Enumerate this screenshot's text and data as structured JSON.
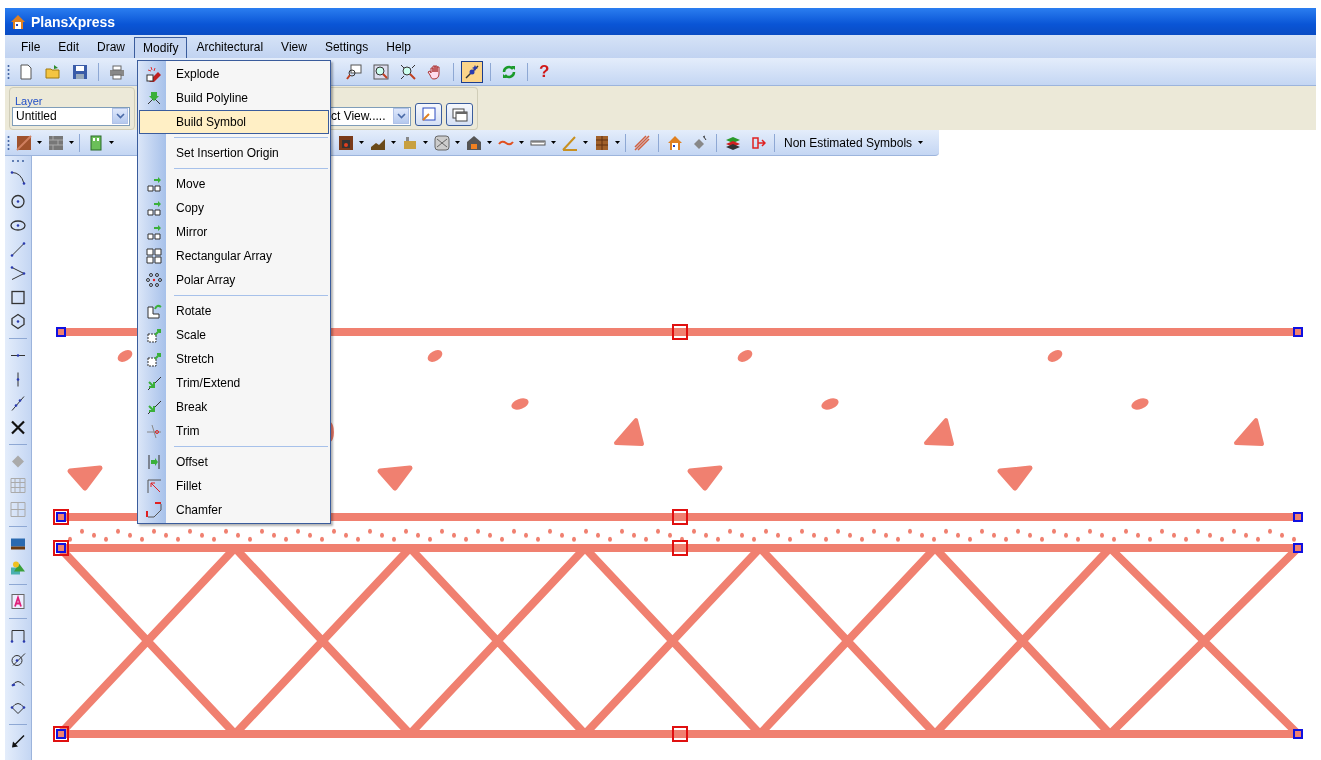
{
  "window": {
    "title": "PlansXpress"
  },
  "menu_bar": [
    {
      "label": "File",
      "selected": false
    },
    {
      "label": "Edit",
      "selected": false
    },
    {
      "label": "Draw",
      "selected": false
    },
    {
      "label": "Modify",
      "selected": true
    },
    {
      "label": "Architectural",
      "selected": false
    },
    {
      "label": "View",
      "selected": false
    },
    {
      "label": "Settings",
      "selected": false
    },
    {
      "label": "Help",
      "selected": false
    }
  ],
  "toolbar_1": {
    "snap_button": {
      "pressed": true
    },
    "help": "?"
  },
  "layer_panel": {
    "label": "Layer",
    "layer_select": "Untitled",
    "view_select": "ct View....."
  },
  "toolbar_2": {
    "symbols_dropdown": "Non Estimated Symbols"
  },
  "dropdown": {
    "items": [
      {
        "kind": "item",
        "label": "Explode",
        "selected": false
      },
      {
        "kind": "item",
        "label": "Build Polyline",
        "selected": false
      },
      {
        "kind": "item",
        "label": "Build Symbol",
        "selected": true
      },
      {
        "kind": "separator"
      },
      {
        "kind": "item",
        "label": "Set Insertion Origin",
        "selected": false
      },
      {
        "kind": "separator"
      },
      {
        "kind": "item",
        "label": "Move",
        "selected": false
      },
      {
        "kind": "item",
        "label": "Copy",
        "selected": false
      },
      {
        "kind": "item",
        "label": "Mirror",
        "selected": false
      },
      {
        "kind": "item",
        "label": "Rectangular Array",
        "selected": false
      },
      {
        "kind": "item",
        "label": "Polar Array",
        "selected": false
      },
      {
        "kind": "separator"
      },
      {
        "kind": "item",
        "label": "Rotate",
        "selected": false
      },
      {
        "kind": "item",
        "label": "Scale",
        "selected": false
      },
      {
        "kind": "item",
        "label": "Stretch",
        "selected": false
      },
      {
        "kind": "item",
        "label": "Trim/Extend",
        "selected": false
      },
      {
        "kind": "item",
        "label": "Break",
        "selected": false
      },
      {
        "kind": "item",
        "label": "Trim",
        "selected": false
      },
      {
        "kind": "separator"
      },
      {
        "kind": "item",
        "label": "Offset",
        "selected": false
      },
      {
        "kind": "item",
        "label": "Fillet",
        "selected": false
      },
      {
        "kind": "item",
        "label": "Chamfer",
        "selected": false
      }
    ]
  }
}
